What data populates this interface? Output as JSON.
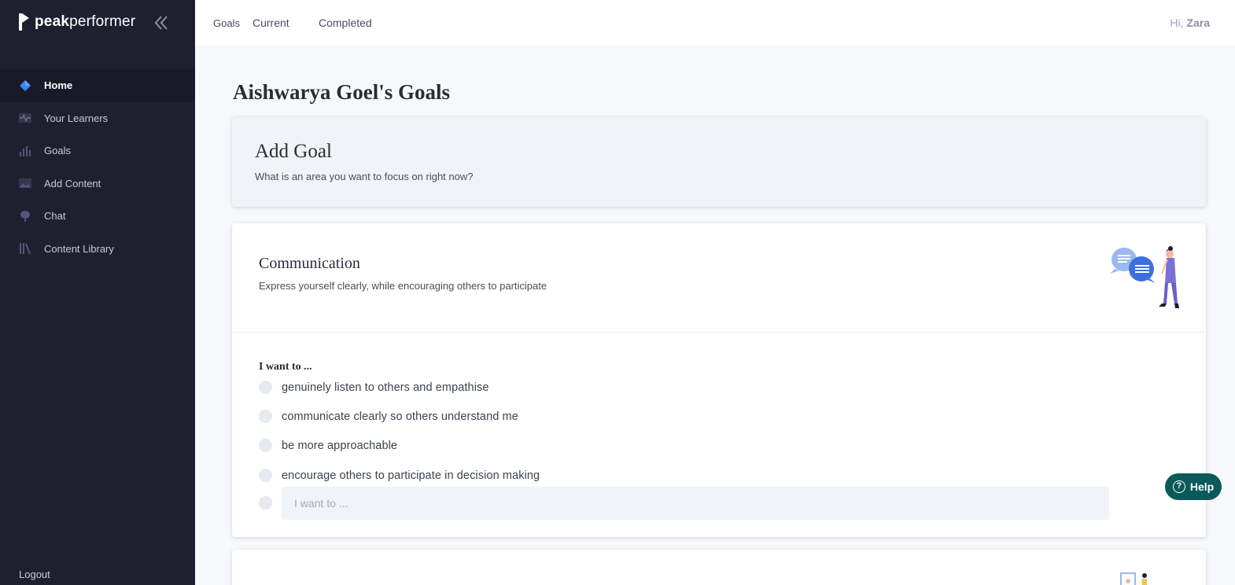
{
  "brand": {
    "bold": "peak",
    "regular": "performer"
  },
  "sidebar": {
    "items": [
      {
        "label": "Home",
        "icon": "home-diamond-icon"
      },
      {
        "label": "Your Learners",
        "icon": "activity-icon"
      },
      {
        "label": "Goals",
        "icon": "bar-chart-icon"
      },
      {
        "label": "Add Content",
        "icon": "image-icon"
      },
      {
        "label": "Chat",
        "icon": "microphone-icon"
      },
      {
        "label": "Content Library",
        "icon": "library-icon"
      }
    ],
    "logout": "Logout"
  },
  "topbar": {
    "tabs": [
      "Goals",
      "Current",
      "Completed"
    ],
    "greeting": "Hi,",
    "user": "Zara"
  },
  "main": {
    "title": "Aishwarya Goel's Goals",
    "add_goal": {
      "title": "Add Goal",
      "subtitle": "What is an area you want to focus on right now?"
    },
    "goal_card": {
      "title": "Communication",
      "description": "Express yourself clearly, while encouraging others to participate",
      "prompt": "I want to ...",
      "options": [
        "genuinely listen to others and empathise",
        "communicate clearly so others understand me",
        "be more approachable",
        "encourage others to participate in decision making"
      ],
      "custom_placeholder": "I want to ..."
    }
  },
  "help": {
    "label": "Help"
  },
  "colors": {
    "sidebar_bg": "#1f1f30",
    "accent_blue": "#3b82f6",
    "help_bg": "#0b5a5a",
    "card_grey": "#f0f3f7"
  }
}
